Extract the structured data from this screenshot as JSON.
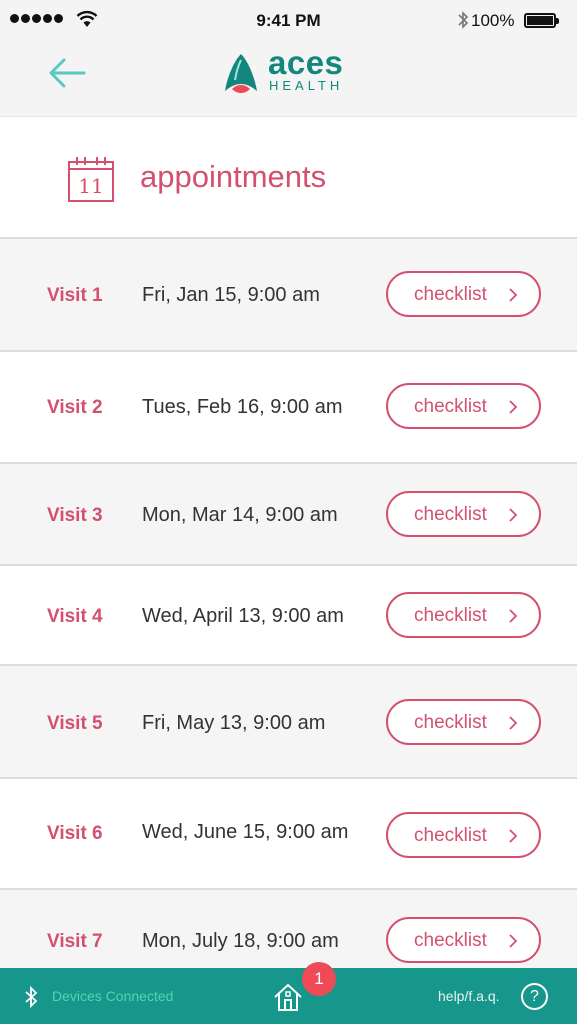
{
  "status_bar": {
    "time": "9:41 PM",
    "battery": "100%"
  },
  "header": {
    "logo_word": "aces",
    "logo_sub": "HEALTH"
  },
  "page": {
    "title": "appointments",
    "calendar_day": "11"
  },
  "appointments": [
    {
      "visit": "Visit 1",
      "date": "Fri, Jan 15, 9:00 am",
      "button": "checklist"
    },
    {
      "visit": "Visit 2",
      "date": "Tues, Feb 16, 9:00 am",
      "button": "checklist"
    },
    {
      "visit": "Visit 3",
      "date": "Mon, Mar 14, 9:00 am",
      "button": "checklist"
    },
    {
      "visit": "Visit 4",
      "date": "Wed, April 13, 9:00 am",
      "button": "checklist"
    },
    {
      "visit": "Visit 5",
      "date": "Fri, May 13, 9:00 am",
      "button": "checklist"
    },
    {
      "visit": "Visit 6",
      "date": "Wed, June 15, 9:00 am",
      "button": "checklist"
    },
    {
      "visit": "Visit 7",
      "date": "Mon, July 18, 9:00 am",
      "button": "checklist"
    }
  ],
  "bottom_bar": {
    "devices_label": "Devices Connected",
    "badge_count": "1",
    "help_label": "help/f.a.q.",
    "question_label": "?"
  },
  "colors": {
    "accent_pink": "#d4506f",
    "brand_teal": "#13877d",
    "bottom_bar": "#17968c",
    "badge_red": "#ef4b57"
  },
  "icons": [
    "back-arrow-icon",
    "calendar-icon",
    "chevron-right-icon",
    "bluetooth-icon",
    "home-icon",
    "help-icon",
    "wifi-icon",
    "battery-icon"
  ]
}
